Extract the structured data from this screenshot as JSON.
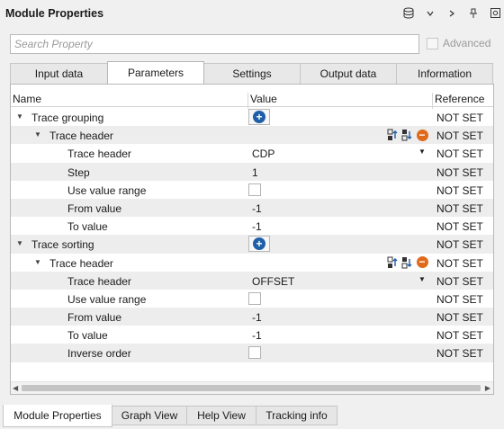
{
  "window": {
    "title": "Module Properties"
  },
  "titlebar": {
    "icons": [
      "database-icon",
      "chevron-down-icon",
      "chevron-right-icon",
      "pin-icon",
      "close-icon"
    ]
  },
  "search": {
    "placeholder": "Search Property",
    "value": ""
  },
  "advanced": {
    "label": "Advanced",
    "checked": false
  },
  "tabs": [
    {
      "label": "Input data",
      "active": false
    },
    {
      "label": "Parameters",
      "active": true
    },
    {
      "label": "Settings",
      "active": false
    },
    {
      "label": "Output data",
      "active": false
    },
    {
      "label": "Information",
      "active": false
    }
  ],
  "grid": {
    "headers": {
      "name": "Name",
      "value": "Value",
      "reference": "Reference"
    },
    "rows": [
      {
        "name": "Trace grouping",
        "value": "",
        "ref": "NOT SET"
      },
      {
        "name": "Trace header",
        "value": "",
        "ref": "NOT SET"
      },
      {
        "name": "Trace header",
        "value": "CDP",
        "ref": "NOT SET"
      },
      {
        "name": "Step",
        "value": "1",
        "ref": "NOT SET"
      },
      {
        "name": "Use value range",
        "value": "",
        "ref": "NOT SET"
      },
      {
        "name": "From value",
        "value": "-1",
        "ref": "NOT SET"
      },
      {
        "name": "To value",
        "value": "-1",
        "ref": "NOT SET"
      },
      {
        "name": "Trace sorting",
        "value": "",
        "ref": "NOT SET"
      },
      {
        "name": "Trace header",
        "value": "",
        "ref": "NOT SET"
      },
      {
        "name": "Trace header",
        "value": "OFFSET",
        "ref": "NOT SET"
      },
      {
        "name": "Use value range",
        "value": "",
        "ref": "NOT SET"
      },
      {
        "name": "From value",
        "value": "-1",
        "ref": "NOT SET"
      },
      {
        "name": "To value",
        "value": "-1",
        "ref": "NOT SET"
      },
      {
        "name": "Inverse order",
        "value": "",
        "ref": "NOT SET"
      }
    ]
  },
  "bottom_tabs": [
    {
      "label": "Module Properties",
      "active": true
    },
    {
      "label": "Graph View",
      "active": false
    },
    {
      "label": "Help View",
      "active": false
    },
    {
      "label": "Tracking info",
      "active": false
    }
  ],
  "colors": {
    "accent_blue": "#1f5fa8",
    "remove_orange": "#e06a1c",
    "alt_row": "#ededed"
  }
}
